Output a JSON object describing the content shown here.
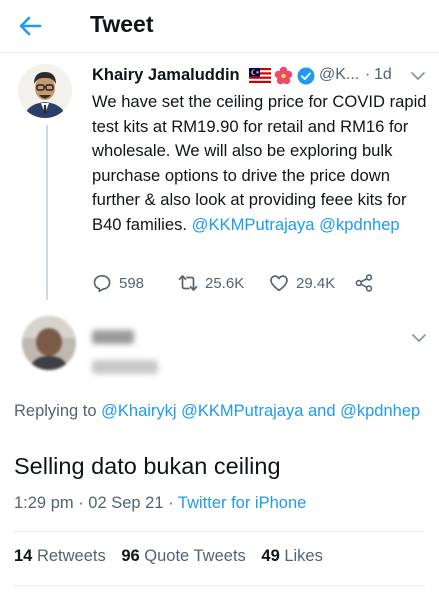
{
  "header": {
    "title": "Tweet"
  },
  "tweet1": {
    "name": "Khairy Jamaluddin",
    "handle": "@K...",
    "sep": "·",
    "time": "1d",
    "text_1": "We have set the ceiling price for COVID rapid test kits at RM19.90 for retail and RM16 for wholesale. We will also be exploring bulk purchase options to drive the price down further & also look at providing feee kits for B40 families. ",
    "mention_1": "@KKMPutrajaya",
    "mention_2": "@kpdnhep",
    "replies": "598",
    "retweets": "25.6K",
    "likes": "29.4K"
  },
  "tweet2": {
    "replying_prefix": "Replying to ",
    "replying_1": "@Khairykj",
    "replying_2": "@KKMPutrajaya",
    "replying_and": " and",
    "replying_3": "@kpdnhep",
    "text": "Selling dato bukan ceiling",
    "time": "1:29 pm",
    "dot": " · ",
    "date": "02 Sep 21",
    "source": "Twitter for iPhone",
    "retweets_count": "14",
    "retweets_label": "Retweets",
    "quotes_count": "96",
    "quotes_label": "Quote Tweets",
    "likes_count": "49",
    "likes_label": "Likes"
  },
  "colors": {
    "accent": "#1d9bf0",
    "muted": "#536471",
    "text": "#0f1419",
    "border": "#e6ecf0"
  },
  "icons": [
    "back-arrow-icon",
    "malaysia-flag-icon",
    "hibiscus-icon",
    "verified-badge-icon",
    "chevron-down-icon",
    "reply-icon",
    "retweet-icon",
    "like-icon",
    "share-icon"
  ]
}
